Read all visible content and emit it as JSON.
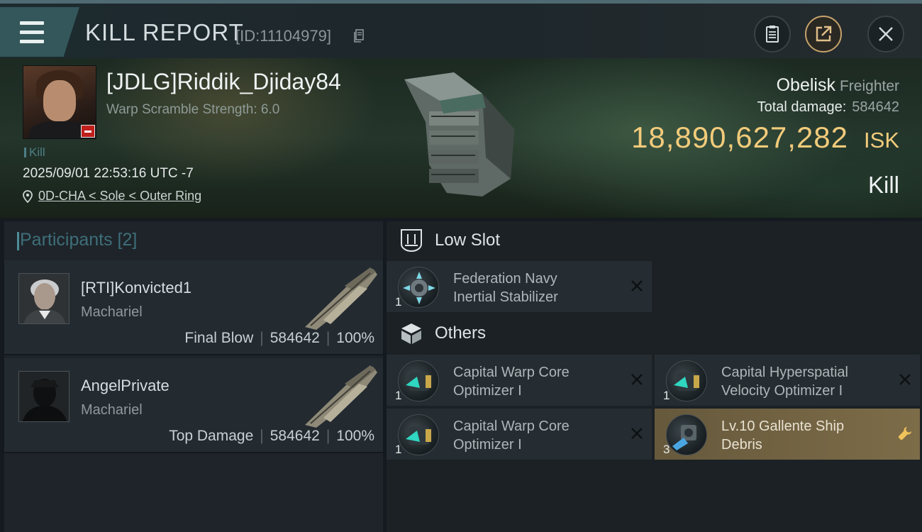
{
  "header": {
    "title": "KILL REPORT",
    "report_id": "[ID:11104979]",
    "icons": [
      "menu-icon",
      "copy-icon",
      "clipboard-icon",
      "share-icon",
      "close-icon"
    ]
  },
  "victim": {
    "name": "[JDLG]Riddik_Djiday84",
    "warp_scramble": "Warp Scramble Strength: 6.0",
    "kill_tag": "Kill",
    "datetime": "2025/09/01 22:53:16 UTC -7",
    "location": "0D-CHA < Sole < Outer Ring"
  },
  "ship": {
    "name": "Obelisk",
    "class": "Freighter",
    "total_damage_label": "Total damage:",
    "total_damage_value": "584642",
    "isk_value": "18,890,627,282",
    "isk_unit": "ISK",
    "result": "Kill"
  },
  "participants": {
    "title": "Participants [2]",
    "rows": [
      {
        "name": "[RTI]Konvicted1",
        "ship": "Machariel",
        "role": "Final Blow",
        "damage": "584642",
        "percent": "100%"
      },
      {
        "name": "AngelPrivate",
        "ship": "Machariel",
        "role": "Top Damage",
        "damage": "584642",
        "percent": "100%"
      }
    ]
  },
  "sections": {
    "low_slot": {
      "label": "Low Slot",
      "items": [
        {
          "name": "Federation Navy Inertial Stabilizer",
          "line1": "Federation Navy",
          "line2": "Inertial Stabilizer",
          "qty": "1"
        }
      ]
    },
    "others": {
      "label": "Others",
      "items": [
        {
          "line1": "Capital Warp Core",
          "line2": "Optimizer I",
          "qty": "1"
        },
        {
          "line1": "Capital Hyperspatial",
          "line2": "Velocity Optimizer I",
          "qty": "1"
        },
        {
          "line1": "Capital Warp Core",
          "line2": "Optimizer I",
          "qty": "1"
        },
        {
          "line1": "Lv.10 Gallente Ship",
          "line2": "Debris",
          "qty": "3"
        }
      ]
    }
  },
  "colors": {
    "isk_gold": "#f2cb7b",
    "accent_teal": "#4d8d99",
    "destroyed_red": "#c0201d",
    "dropped_item_gold": "#7d6c48"
  }
}
